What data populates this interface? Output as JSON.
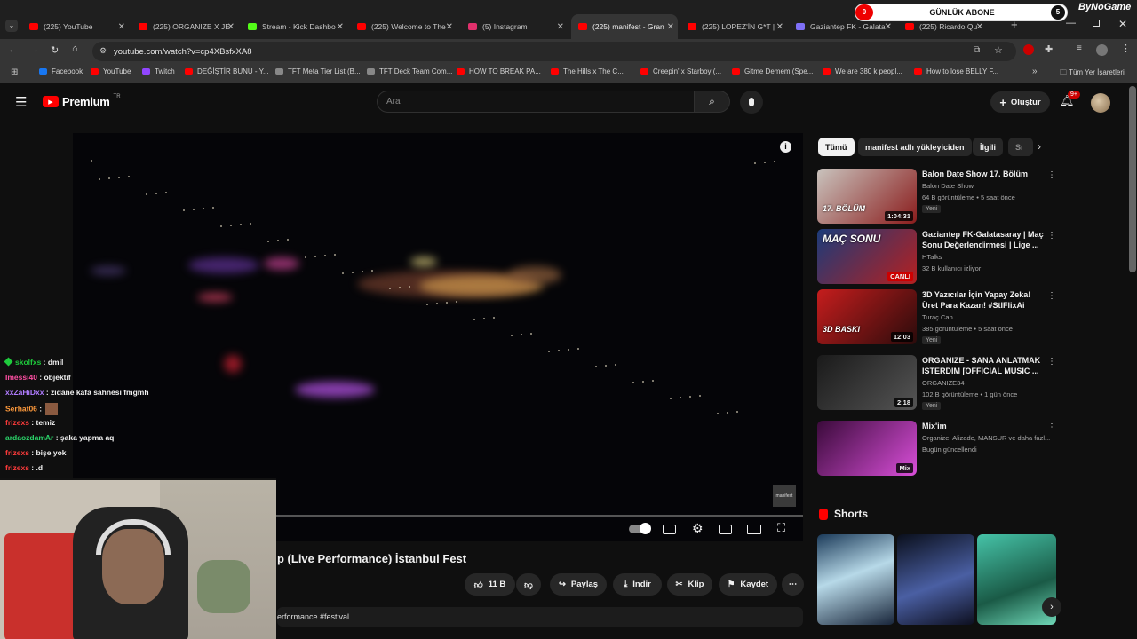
{
  "tabs": [
    {
      "title": "(225) YouTube",
      "color": "#ff0000"
    },
    {
      "title": "(225) ORGANIZE X JE",
      "color": "#ff0000"
    },
    {
      "title": "Stream - Kick Dashbo",
      "color": "#53fc18"
    },
    {
      "title": "(225) Welcome to The",
      "color": "#ff0000"
    },
    {
      "title": "(5) Instagram",
      "color": "#e1306c"
    },
    {
      "title": "(225) manifest - Gran",
      "color": "#ff0000"
    },
    {
      "title": "(225) LOPEZ'İN G*T |",
      "color": "#ff0000"
    },
    {
      "title": "Gaziantep FK - Galata",
      "color": "#7e6ff7"
    },
    {
      "title": "(225) Ricardo Qu",
      "color": "#ff0000"
    }
  ],
  "overlay": {
    "subs_label": "GÜNLÜK ABONE",
    "subs_left": "0",
    "subs_right": "5",
    "channel": "ByNoGame"
  },
  "address": {
    "url": "youtube.com/watch?v=cp4XBsfxXA8"
  },
  "bookmarks": [
    {
      "label": "Facebook",
      "color": "#1877f2"
    },
    {
      "label": "YouTube",
      "color": "#ff0000"
    },
    {
      "label": "Twitch",
      "color": "#9146ff"
    },
    {
      "label": "DEĞİŞTİR BUNU - Y...",
      "color": "#ff0000"
    },
    {
      "label": "TFT Meta Tier List (B...",
      "color": "#888888"
    },
    {
      "label": "TFT Deck Team Com...",
      "color": "#888888"
    },
    {
      "label": "HOW TO BREAK PA...",
      "color": "#ff0000"
    },
    {
      "label": "The Hills x The C...",
      "color": "#ff0000"
    },
    {
      "label": "Creepin' x Starboy (...",
      "color": "#ff0000"
    },
    {
      "label": "Gitme Demem (Spe...",
      "color": "#ff0000"
    },
    {
      "label": "We are 380 k peopl...",
      "color": "#ff0000"
    },
    {
      "label": "How to lose BELLY F...",
      "color": "#ff0000"
    }
  ],
  "bookmarks_other": "Tüm Yer İşaretleri",
  "yt": {
    "logo": "Premium",
    "logo_sup": "TR",
    "search_placeholder": "Ara",
    "create_label": "Oluştur",
    "notif_count": "9+"
  },
  "video": {
    "watermark": "manifest",
    "title": "p (Live Performance) İstanbul Fest",
    "likes": "11 B",
    "share": "Paylaş",
    "download": "İndir",
    "clip": "Klip",
    "save": "Kaydet",
    "desc_snippet": "erformance #festival"
  },
  "chat": [
    {
      "name": "skolfxs",
      "msg": ": dmil",
      "color": "#1ecb3c"
    },
    {
      "name": "Imessi40",
      "msg": ": objektif",
      "color": "#ff4fa3"
    },
    {
      "name": "xxZaHiDxx",
      "msg": ": zidane kafa sahnesi fmgmh",
      "color": "#b07cff"
    },
    {
      "name": "Serhat06",
      "msg": ":",
      "color": "#ff9a3c"
    },
    {
      "name": "frizexs",
      "msg": ": temiz",
      "color": "#ff3b3b"
    },
    {
      "name": "ardaozdamAr",
      "msg": ": şaka yapma aq",
      "color": "#2bd46a"
    },
    {
      "name": "frizexs",
      "msg": ": bişe yok",
      "color": "#ff3b3b"
    },
    {
      "name": "frizexs",
      "msg": ": .d",
      "color": "#ff3b3b"
    }
  ],
  "chips": [
    "Tümü",
    "manifest adlı yükleyiciden",
    "İlgili",
    "Sı"
  ],
  "recs": [
    {
      "title": "Balon Date Show 17. Bölüm",
      "channel": "Balon Date Show",
      "meta": "64 B görüntüleme • 5 saat önce",
      "badge": "Yeni",
      "duration": "1:04:31",
      "thumb_label": "17. BÖLÜM",
      "colors": [
        "#c9c3bd",
        "#8a1c1c"
      ]
    },
    {
      "title": "Gaziantep FK-Galatasaray | Maç Sonu Değerlendirmesi | Lige ...",
      "channel": "HTalks",
      "meta": "32 B kullanıcı izliyor",
      "badge": "",
      "duration": "CANLI",
      "thumb_label": "MAÇ SONU",
      "colors": [
        "#1b3b7a",
        "#b52020"
      ]
    },
    {
      "title": "3D Yazıcılar İçin Yapay Zeka! Üret Para Kazan! #StIFlixAi",
      "channel": "Turaç Can",
      "meta": "385 görüntüleme • 5 saat önce",
      "badge": "Yeni",
      "duration": "12:03",
      "thumb_label": "3D BASKI",
      "colors": [
        "#c51d1d",
        "#2a0b0b"
      ]
    },
    {
      "title": "ORGANIZE - SANA ANLATMAK ISTERDIM [OFFICIAL MUSIC ...",
      "channel": "ORGANIZE34",
      "meta": "102 B görüntüleme • 1 gün önce",
      "badge": "Yeni",
      "duration": "2:18",
      "thumb_label": "",
      "colors": [
        "#1a1a1a",
        "#555555"
      ]
    },
    {
      "title": "Mix'im",
      "channel": "Organize, Alizade, MANSUR ve daha fazl...",
      "meta": "Bugün güncellendi",
      "badge": "",
      "duration": "Mix",
      "thumb_label": "",
      "colors": [
        "#3a0a3a",
        "#d94fd9"
      ]
    }
  ],
  "shorts_title": "Shorts"
}
